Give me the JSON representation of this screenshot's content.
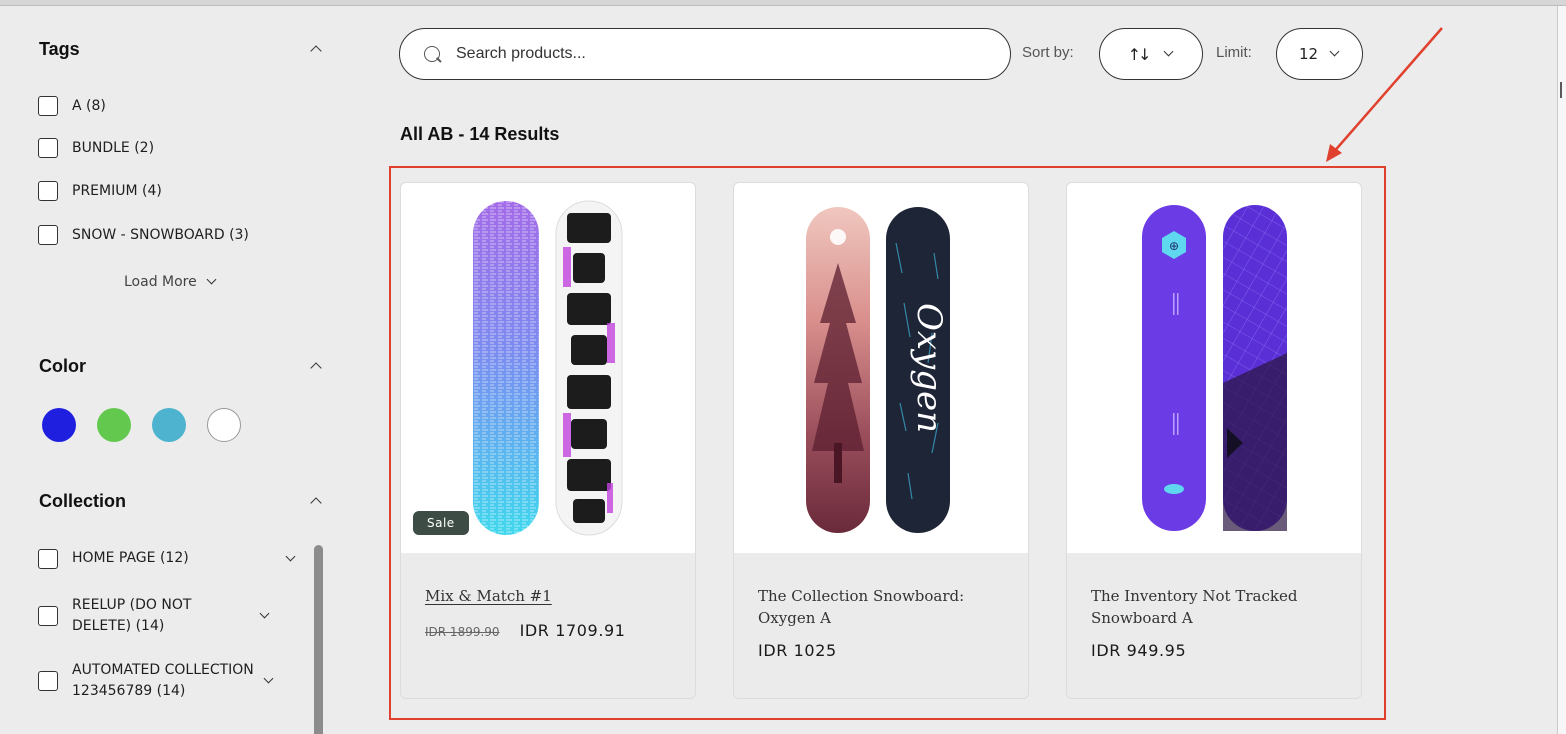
{
  "sidebar": {
    "tags": {
      "title": "Tags",
      "items": [
        "A (8)",
        "BUNDLE (2)",
        "PREMIUM (4)",
        "SNOW - SNOWBOARD (3)"
      ],
      "load_more": "Load More"
    },
    "color": {
      "title": "Color",
      "swatches": [
        "#1f1fe0",
        "#62c94e",
        "#4db3cf",
        "#ffffff"
      ]
    },
    "collection": {
      "title": "Collection",
      "items": [
        "HOME PAGE (12)",
        "REELUP (DO NOT DELETE) (14)",
        "AUTOMATED COLLECTION 123456789 (14)"
      ]
    }
  },
  "toolbar": {
    "search_placeholder": "Search products...",
    "sort_label": "Sort by:",
    "sort_icon": "↑↓",
    "limit_label": "Limit:",
    "limit_value": "12"
  },
  "results_heading": "All AB - 14 Results",
  "products": [
    {
      "title": "Mix & Match #1",
      "badge": "Sale",
      "compare_price": "IDR 1899.90",
      "price": "IDR 1709.91"
    },
    {
      "title": "The Collection Snowboard: Oxygen A",
      "price": "IDR 1025"
    },
    {
      "title": "The Inventory Not Tracked Snowboard A",
      "price": "IDR 949.95"
    }
  ],
  "colors": {
    "highlight": "#e0412f",
    "sale_badge": "#3d4c45"
  }
}
